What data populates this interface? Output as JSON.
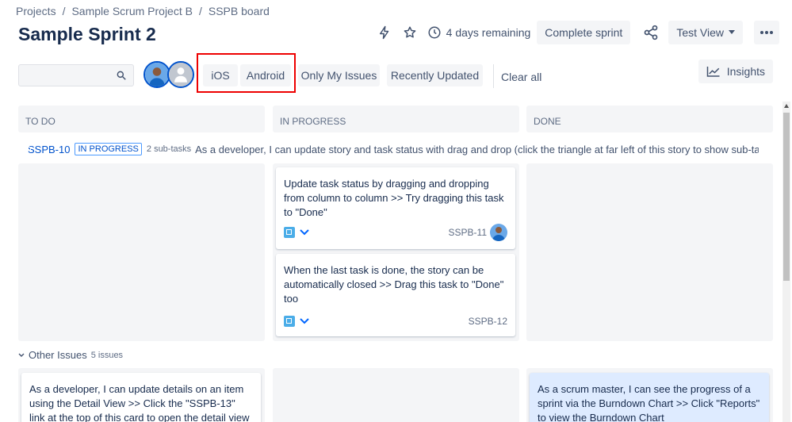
{
  "breadcrumb": [
    "Projects",
    "Sample Scrum Project B",
    "SSPB board"
  ],
  "page_title": "Sample Sprint 2",
  "header": {
    "remaining": "4 days remaining",
    "complete_sprint": "Complete sprint",
    "view_label": "Test View"
  },
  "filters": {
    "search_placeholder": "",
    "quick_filters": [
      "iOS",
      "Android",
      "Only My Issues",
      "Recently Updated"
    ],
    "clear_all": "Clear all",
    "insights": "Insights"
  },
  "columns": [
    "TO DO",
    "IN PROGRESS",
    "DONE"
  ],
  "story": {
    "key": "SSPB-10",
    "status": "IN PROGRESS",
    "subtasks": "2 sub-tasks",
    "summary": "As a developer, I can update story and task status with drag and drop (click the triangle at far left of this story to show sub-ta"
  },
  "cards": [
    {
      "text": "Update task status by dragging and dropping from column to column >> Try dragging this task to \"Done\"",
      "key": "SSPB-11"
    },
    {
      "text": "When the last task is done, the story can be automatically closed >> Drag this task to \"Done\" too",
      "key": "SSPB-12"
    }
  ],
  "other_issues": {
    "label": "Other Issues",
    "count": "5 issues",
    "todo_card": "As a developer, I can update details on an item using the Detail View >> Click the \"SSPB-13\" link at the top of this card to open the detail view",
    "done_card": "As a scrum master, I can see the progress of a sprint via the Burndown Chart >> Click \"Reports\" to view the Burndown Chart"
  },
  "colors": {
    "accent": "#0052cc",
    "highlight": "#e00000",
    "story_green": "#36b37e",
    "subtask_blue": "#4bade8"
  }
}
